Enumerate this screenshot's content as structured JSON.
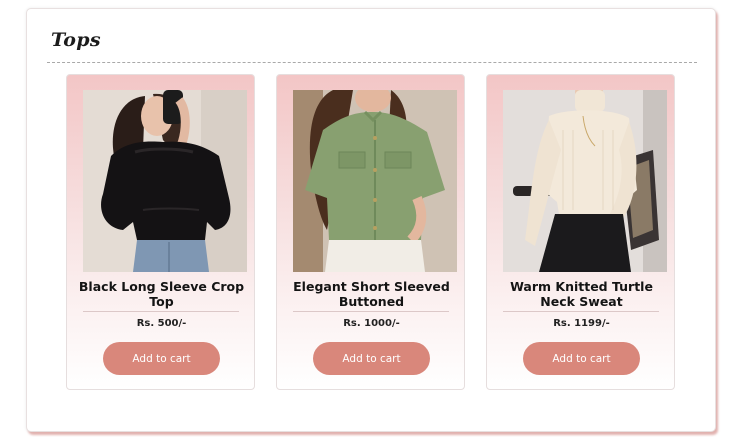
{
  "section": {
    "title": "Tops"
  },
  "products": [
    {
      "name": "Black Long Sleeve Crop Top",
      "price": "Rs. 500/-",
      "button_label": "Add to cart",
      "image": "black-crop-top-photo"
    },
    {
      "name": "Elegant Short Sleeved Buttoned",
      "price": "Rs. 1000/-",
      "button_label": "Add to cart",
      "image": "green-buttoned-blouse-photo"
    },
    {
      "name": "Warm Knitted Turtle Neck Sweat",
      "price": "Rs. 1199/-",
      "button_label": "Add to cart",
      "image": "cream-turtleneck-photo"
    }
  ],
  "colors": {
    "accent_button": "#d9877b",
    "card_gradient_top": "#f3c6c6",
    "panel_shadow": "#d89a96"
  }
}
